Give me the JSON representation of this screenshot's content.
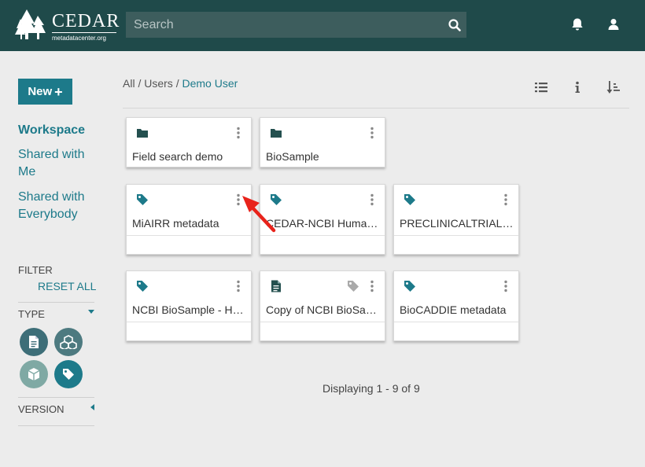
{
  "header": {
    "logo_title": "CEDAR",
    "logo_subtitle": "metadatacenter.org",
    "search_placeholder": "Search",
    "icons": [
      "search-icon",
      "bell-icon",
      "user-icon"
    ]
  },
  "sidebar": {
    "new_label": "New",
    "nav": [
      {
        "label": "Workspace",
        "active": true
      },
      {
        "label": "Shared with Me",
        "lines": [
          "Shared with",
          "Me"
        ]
      },
      {
        "label": "Shared with Everybody",
        "lines": [
          "Shared with",
          "Everybody"
        ]
      }
    ],
    "filter_label": "FILTER",
    "reset_label": "RESET ALL",
    "type_label": "TYPE",
    "type_filters": [
      {
        "icon": "document-icon",
        "color": "#3d6e78",
        "state": "active"
      },
      {
        "icon": "cubes-icon",
        "color": "#4d7a80",
        "state": "active"
      },
      {
        "icon": "cube-icon",
        "color": "#7fa9a4",
        "state": "inactive"
      },
      {
        "icon": "tag-icon",
        "color": "#1d7a8a",
        "state": "active"
      }
    ],
    "version_label": "VERSION"
  },
  "breadcrumb": {
    "parts": [
      "All",
      "Users"
    ],
    "current": "Demo User",
    "separator": "/"
  },
  "toolbar_icons": [
    "list-view-icon",
    "info-icon",
    "sort-icon"
  ],
  "cards": [
    {
      "type": "folder",
      "title": "Field search demo"
    },
    {
      "type": "folder",
      "title": "BioSample"
    },
    {
      "type": "template",
      "title": "MiAIRR metadata"
    },
    {
      "type": "template",
      "title": "CEDAR-NCBI Human Tissue"
    },
    {
      "type": "template",
      "title": "PRECLINICALTRIALS.EU"
    },
    {
      "type": "template",
      "title": "NCBI BioSample - Human"
    },
    {
      "type": "instance",
      "title": "Copy of NCBI BioSample"
    },
    {
      "type": "template",
      "title": "BioCADDIE metadata"
    }
  ],
  "footer": {
    "count_text": "Displaying 1 - 9 of 9"
  },
  "colors": {
    "header_bg": "#1f4a4a",
    "accent": "#1d7a8a",
    "page_bg": "#ececec",
    "arrow": "#e8231b"
  }
}
